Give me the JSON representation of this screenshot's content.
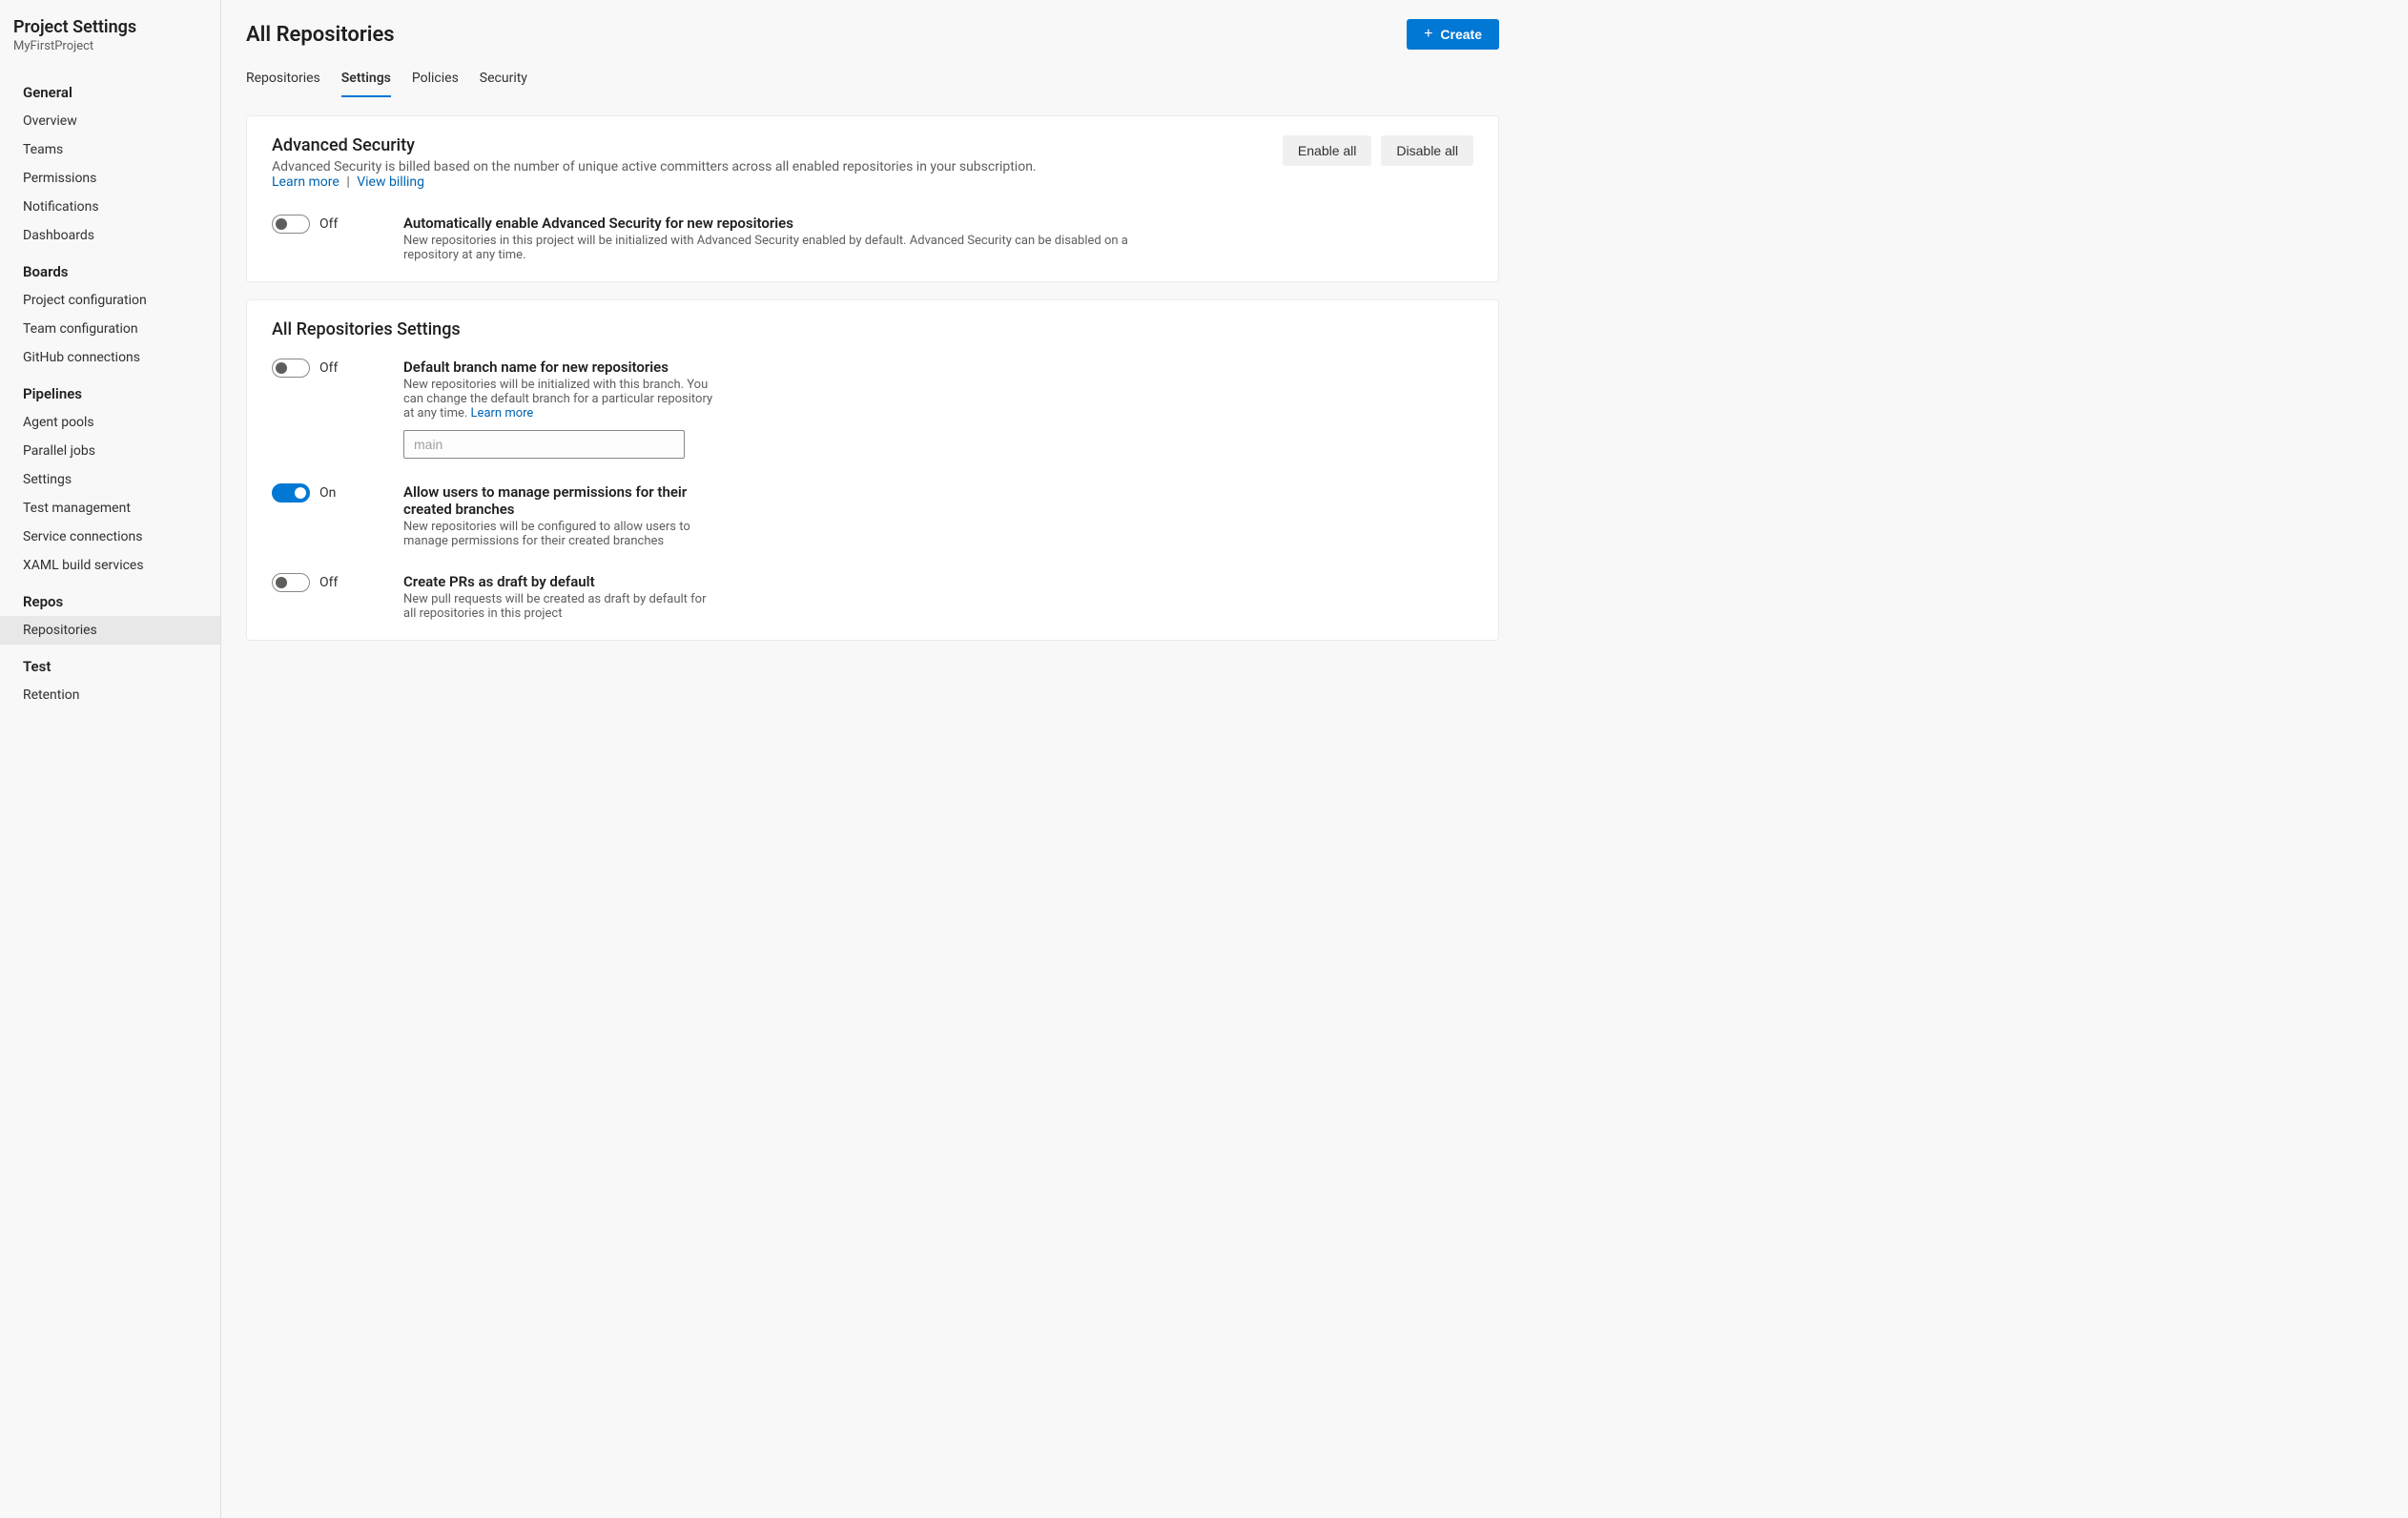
{
  "sidebar": {
    "title": "Project Settings",
    "project": "MyFirstProject",
    "groups": [
      {
        "title": "General",
        "items": [
          "Overview",
          "Teams",
          "Permissions",
          "Notifications",
          "Dashboards"
        ]
      },
      {
        "title": "Boards",
        "items": [
          "Project configuration",
          "Team configuration",
          "GitHub connections"
        ]
      },
      {
        "title": "Pipelines",
        "items": [
          "Agent pools",
          "Parallel jobs",
          "Settings",
          "Test management",
          "Service connections",
          "XAML build services"
        ]
      },
      {
        "title": "Repos",
        "items": [
          "Repositories"
        ]
      },
      {
        "title": "Test",
        "items": [
          "Retention"
        ]
      }
    ],
    "active": "Repositories"
  },
  "header": {
    "title": "All Repositories",
    "create": "Create"
  },
  "tabs": {
    "items": [
      "Repositories",
      "Settings",
      "Policies",
      "Security"
    ],
    "active": "Settings"
  },
  "advanced": {
    "title": "Advanced Security",
    "desc": "Advanced Security is billed based on the number of unique active committers across all enabled repositories in your subscription.",
    "learn": "Learn more",
    "billing": "View billing",
    "enable_all": "Enable all",
    "disable_all": "Disable all",
    "setting": {
      "state": "Off",
      "on": false,
      "title": "Automatically enable Advanced Security for new repositories",
      "desc": "New repositories in this project will be initialized with Advanced Security enabled by default. Advanced Security can be disabled on a repository at any time."
    }
  },
  "repo_settings": {
    "title": "All Repositories Settings",
    "items": [
      {
        "state": "Off",
        "on": false,
        "title": "Default branch name for new repositories",
        "desc": "New repositories will be initialized with this branch. You can change the default branch for a particular repository at any time.",
        "learn": "Learn more",
        "input_placeholder": "main",
        "narrow": true,
        "has_input": true
      },
      {
        "state": "On",
        "on": true,
        "title": "Allow users to manage permissions for their created branches",
        "desc": "New repositories will be configured to allow users to manage permissions for their created branches",
        "narrow": true
      },
      {
        "state": "Off",
        "on": false,
        "title": "Create PRs as draft by default",
        "desc": "New pull requests will be created as draft by default for all repositories in this project",
        "narrow": true
      }
    ]
  }
}
